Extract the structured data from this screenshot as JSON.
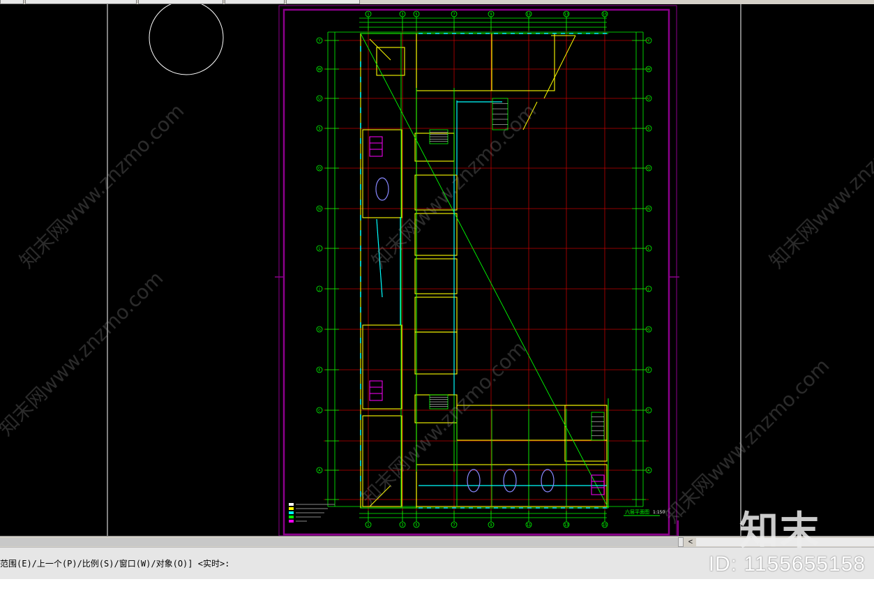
{
  "toolbar_tabs": [
    "",
    "",
    "",
    "",
    ""
  ],
  "drawing": {
    "title_label": "六层平面图",
    "scale_label": "1:150",
    "column_axes": [
      "1",
      "3",
      "5",
      "7",
      "9",
      "11",
      "13",
      "15"
    ],
    "row_axes": [
      "Y",
      "W",
      "U",
      "S",
      "Q",
      "N",
      "L",
      "J",
      "G",
      "E",
      "C",
      "A"
    ]
  },
  "command": {
    "line": "范围(E)/上一个(P)/比例(S)/窗口(W)/对象(O)] <实时>:"
  },
  "scrollbar": {
    "arrow": "<"
  },
  "watermark": {
    "site_text": "知末网www.znzmo.com",
    "logo_text": "知末",
    "id_text": "ID: 1155655158"
  },
  "colors": {
    "background": "#000000",
    "frame": "#8b008b",
    "grid_green": "#00ff00",
    "axis_red": "#c00000",
    "wall_yellow": "#ffff00",
    "glass_cyan": "#00ffff",
    "accent_magenta": "#ff00ff"
  }
}
